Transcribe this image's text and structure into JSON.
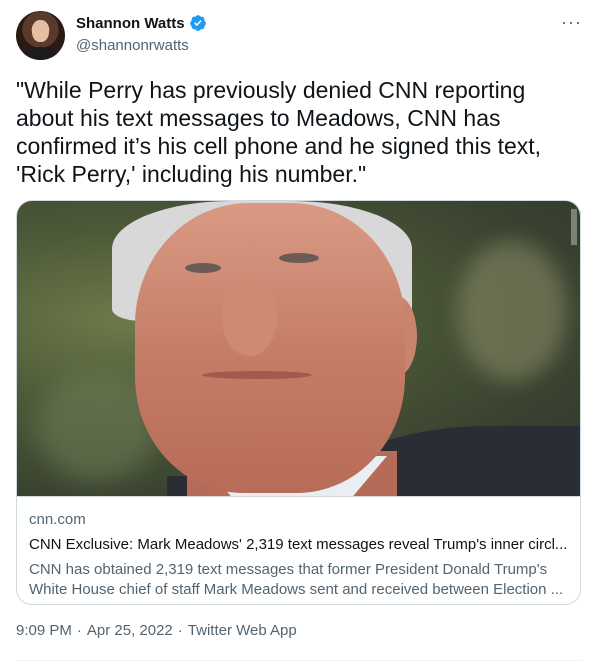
{
  "author": {
    "display_name": "Shannon Watts",
    "handle": "@shannonrwatts",
    "verified_icon": "verified-badge-icon",
    "avatar": "profile-photo"
  },
  "more_icon": "more-options-icon",
  "more_glyph": "···",
  "tweet_text": "\"While Perry has previously denied CNN reporting\nabout his text messages to Meadows, CNN has\nconfirmed it’s his cell phone and he signed this text,\n'Rick Perry,' including his number.\"",
  "card": {
    "image_alt": "Photo of Mark Meadows",
    "domain": "cnn.com",
    "title": "CNN Exclusive: Mark Meadows' 2,319 text messages reveal Trump's inner circl...",
    "description_line1": "CNN has obtained 2,319 text messages that former President Donald Trump's",
    "description_line2": "White House chief of staff Mark Meadows sent and received between Election ..."
  },
  "meta": {
    "time": "9:09 PM",
    "separator": "·",
    "date": "Apr 25, 2022",
    "source": "Twitter Web App"
  },
  "colors": {
    "text_primary": "#0f1419",
    "text_secondary": "#536471",
    "verified_blue": "#1d9bf0",
    "border": "#cfd9de"
  }
}
